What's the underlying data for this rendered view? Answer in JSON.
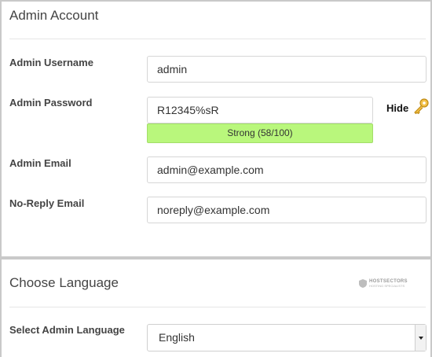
{
  "admin_account": {
    "title": "Admin Account",
    "username": {
      "label": "Admin Username",
      "value": "admin"
    },
    "password": {
      "label": "Admin Password",
      "value": "R12345%sR",
      "strength_text": "Strong (58/100)",
      "strength_color": "#b9f77c",
      "toggle_label": "Hide",
      "toggle_icon": "key-icon"
    },
    "email": {
      "label": "Admin Email",
      "value": "admin@example.com"
    },
    "noreply": {
      "label": "No-Reply Email",
      "value": "noreply@example.com"
    }
  },
  "language": {
    "title": "Choose Language",
    "select_label": "Select Admin Language",
    "selected": "English"
  },
  "watermark": {
    "brand": "HOSTSECTORS",
    "tagline": "HOSTING SPECIALISTS"
  }
}
